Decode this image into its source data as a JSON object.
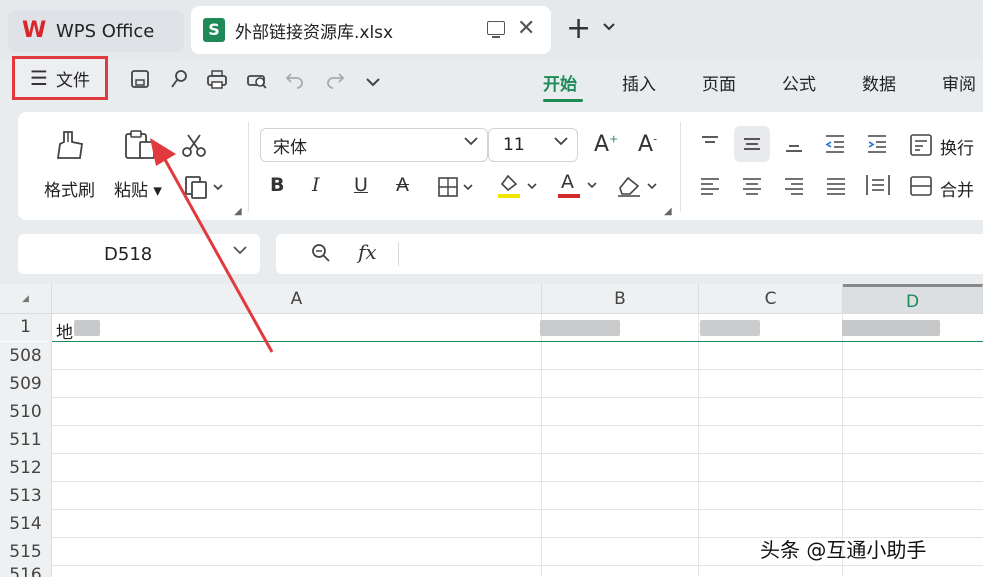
{
  "tabs": {
    "app_label": "WPS Office",
    "file_tab_label": "外部链接资源库.xlsx",
    "sheet_icon_letter": "S",
    "close_glyph": "✕",
    "new_tab_glyph": "+",
    "more_glyph": "⌄"
  },
  "toolbar": {
    "file_menu_label": "文件",
    "menu_tabs": [
      "开始",
      "插入",
      "页面",
      "公式",
      "数据",
      "审阅"
    ],
    "active_tab_index": 0,
    "quick_icons": [
      "save-icon",
      "format-painter-quick-icon",
      "print-icon",
      "print-preview-icon",
      "undo-icon",
      "redo-icon",
      "more-dropdown-icon"
    ]
  },
  "ribbon": {
    "format_painter_label": "格式刷",
    "paste_label": "粘贴",
    "font_name": "宋体",
    "font_size": "11",
    "wrap_label": "换行",
    "merge_label": "合并",
    "bold": "B",
    "italic": "I",
    "underline": "U",
    "strike": "A",
    "grow_font": "A",
    "shrink_font": "A",
    "font_color_letter": "A",
    "fill_color": "#f2e600",
    "font_color": "#d12b2b"
  },
  "formula_bar": {
    "name_box_value": "D518",
    "fx_label": "fx",
    "formula_value": ""
  },
  "sheet": {
    "columns": [
      "A",
      "B",
      "C",
      "D"
    ],
    "selected_column": "D",
    "rows": [
      "1",
      "508",
      "509",
      "510",
      "511",
      "512",
      "513",
      "514",
      "515",
      "516"
    ],
    "cell_a1_visible": "地"
  },
  "annotation": {
    "highlight_color": "#e03a3e",
    "arrow_color": "#e03a3e"
  },
  "watermark": "头条 @互通小助手",
  "accent_color": "#1e8a55"
}
